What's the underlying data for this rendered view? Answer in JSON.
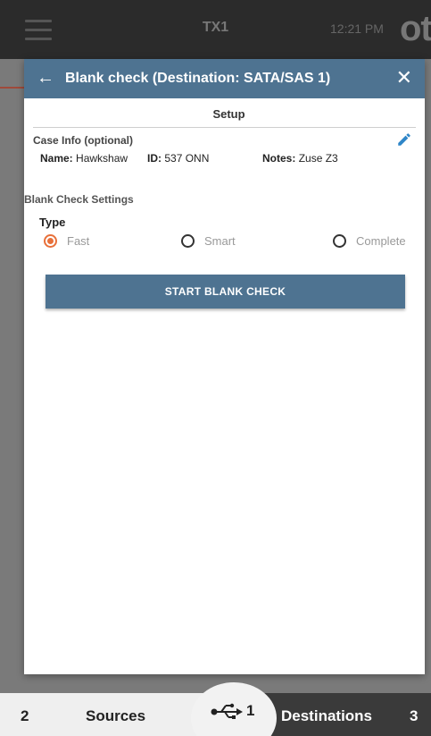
{
  "appbar": {
    "device_title": "TX1",
    "time": "12:21 PM",
    "logo_text": "ot"
  },
  "dialog": {
    "title": "Blank check (Destination: SATA/SAS 1)",
    "back_icon": "arrow-left-icon",
    "close_icon": "close-icon",
    "section_title": "Setup",
    "case_info": {
      "label": "Case Info (optional)",
      "edit_icon": "pencil-icon",
      "name_label": "Name:",
      "name_value": "Hawkshaw",
      "id_label": "ID:",
      "id_value": "537 ONN",
      "notes_label": "Notes:",
      "notes_value": "Zuse Z3"
    },
    "settings": {
      "label": "Blank Check Settings",
      "type_label": "Type",
      "options": [
        {
          "label": "Fast",
          "selected": true
        },
        {
          "label": "Smart",
          "selected": false
        },
        {
          "label": "Complete",
          "selected": false
        }
      ]
    },
    "start_button": "START BLANK CHECK"
  },
  "bottombar": {
    "sources_count": "2",
    "sources_label": "Sources",
    "usb_icon": "usb-icon",
    "usb_count": "1",
    "destinations_label": "Destinations",
    "destinations_count": "3"
  },
  "colors": {
    "header_blue": "#4e7391",
    "accent_orange": "#e8703a",
    "appbar_dark": "#2b2b2b"
  }
}
